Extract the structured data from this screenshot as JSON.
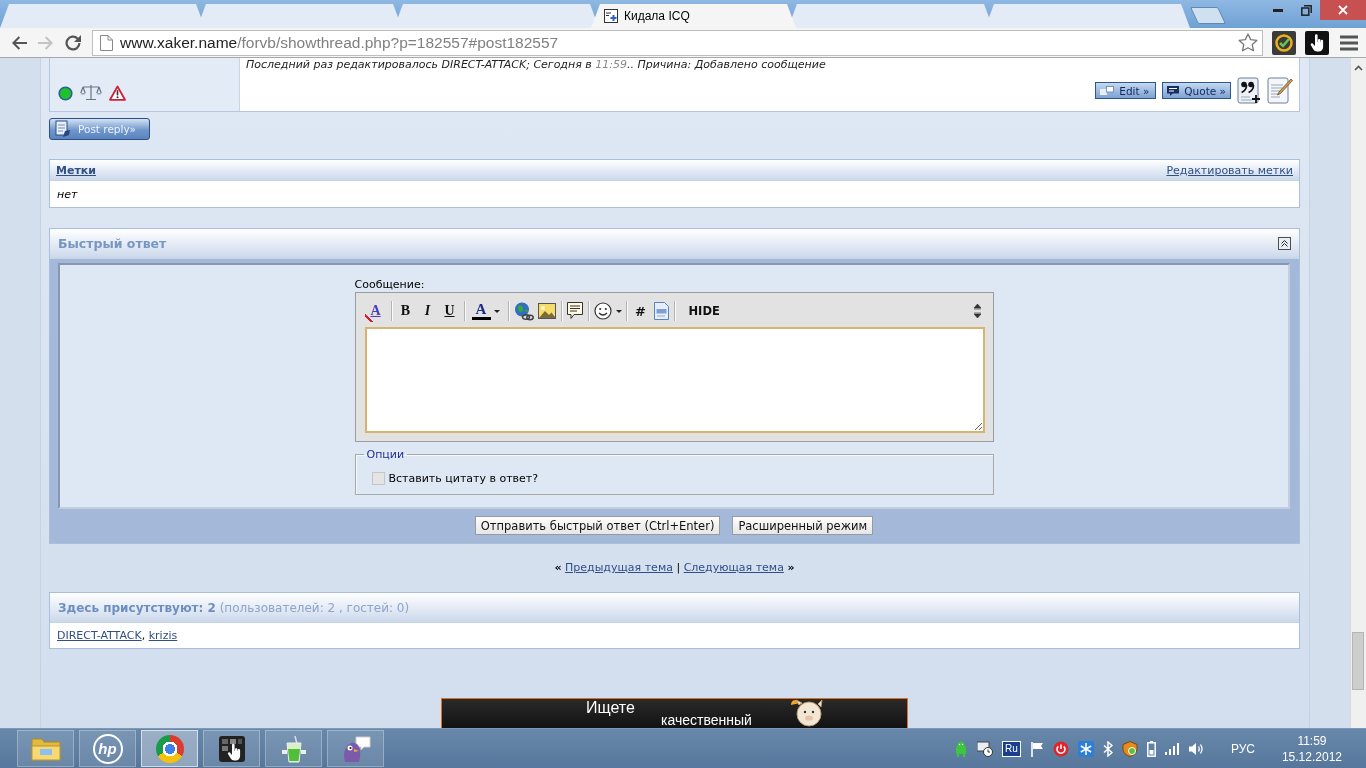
{
  "browser": {
    "tabs": [
      {
        "selected": false
      },
      {
        "selected": false
      },
      {
        "selected": false
      },
      {
        "title": "Кидала ICQ",
        "selected": true
      },
      {
        "selected": false
      },
      {
        "selected": false
      }
    ],
    "nav_buttons": [
      {
        "kind": "back",
        "disabled": false
      },
      {
        "kind": "forward",
        "disabled": true
      },
      {
        "kind": "reload",
        "disabled": false
      }
    ],
    "address": {
      "host": "www.xaker.name",
      "path": "/forvb/showthread.php?p=182557#post182557"
    },
    "bookmarked": false
  },
  "post": {
    "online": true,
    "edit_note": {
      "before": "Последний раз редактировалось DIRECT-ATTACK; Сегодня в ",
      "time": "11:59",
      "after": ".. Причина: Добавлено сообщение"
    },
    "buttons": [
      {
        "kind": "edit",
        "label": "Edit »"
      },
      {
        "kind": "quote",
        "label": "Quote »"
      }
    ]
  },
  "post_reply": {
    "label": "Post reply»"
  },
  "tags": {
    "title": "Метки",
    "edit_link": "Редактировать метки",
    "value": "нет"
  },
  "quick_reply": {
    "title": "Быстрый ответ",
    "expanded": true,
    "message_label": "Сообщение:",
    "toolbar": [
      [
        {
          "kind": "remove-format",
          "glyph": "A"
        }
      ],
      [
        {
          "kind": "bold",
          "glyph": "B"
        },
        {
          "kind": "italic",
          "glyph": "I"
        },
        {
          "kind": "underline",
          "glyph": "U"
        }
      ],
      [
        {
          "kind": "font-color",
          "glyph": "A"
        }
      ],
      [
        {
          "kind": "link"
        },
        {
          "kind": "image"
        }
      ],
      [
        {
          "kind": "quote"
        }
      ],
      [
        {
          "kind": "smilies"
        }
      ],
      [
        {
          "kind": "code",
          "glyph": "#"
        },
        {
          "kind": "php"
        }
      ],
      [
        {
          "kind": "hide",
          "glyph": "HIDE"
        }
      ]
    ],
    "options": {
      "legend": "Опции",
      "items": [
        {
          "label": "Вставить цитату в ответ?",
          "checked": false,
          "disabled": true
        }
      ]
    },
    "buttons": [
      {
        "label": "Отправить быстрый ответ (Ctrl+Enter)"
      },
      {
        "label": "Расширенный режим"
      }
    ]
  },
  "thread_nav": {
    "prev_mark": "«",
    "prev": "Предыдущая тема",
    "divider": "|",
    "next": "Следующая тема",
    "next_mark": "»"
  },
  "online_users": {
    "header": "**Здесь присутствуют: 2** (пользователей: 2 , гостей: 0)",
    "users": [
      "DIRECT-ATTACK",
      "krizis"
    ],
    "separator": ","
  },
  "banner": {
    "line_1": "Ищете",
    "line_2": "качественный"
  },
  "taskbar": {
    "apps": [
      {
        "selected": false
      },
      {
        "selected": false,
        "logo_text": "hp"
      },
      {
        "selected": true
      },
      {
        "selected": false
      },
      {
        "selected": false
      },
      {
        "selected": false
      }
    ],
    "tray": {
      "keyboard_badge": "Ru",
      "language": "РУС",
      "time": "11:59",
      "date": "15.12.2012"
    }
  }
}
